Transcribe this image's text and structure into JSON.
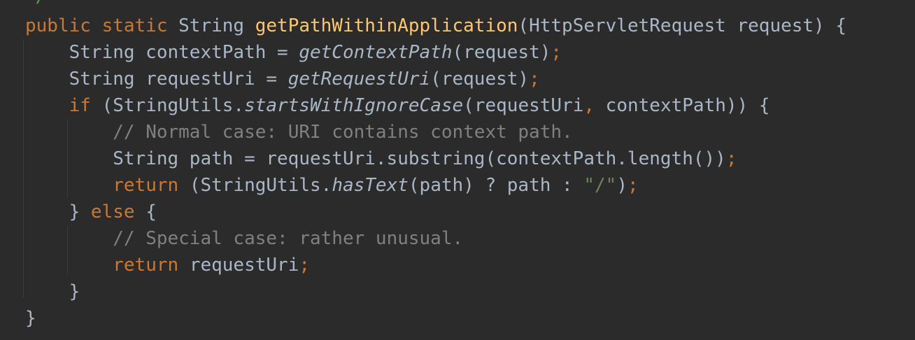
{
  "editor": {
    "top_fragment": "*/",
    "colors": {
      "background": "#2b2b2b",
      "default_text": "#a9b7c6",
      "keyword": "#cc7832",
      "method_declaration": "#ffc66d",
      "comment": "#808080",
      "string": "#6a8759",
      "doc_comment": "#629755"
    },
    "lines": [
      {
        "tokens": [
          {
            "t": "public static ",
            "c": "kw"
          },
          {
            "t": "String ",
            "c": ""
          },
          {
            "t": "getPathWithinApplication",
            "c": "fn"
          },
          {
            "t": "(HttpServletRequest request) {",
            "c": ""
          }
        ]
      },
      {
        "tokens": [
          {
            "t": "    String contextPath = ",
            "c": ""
          },
          {
            "t": "getContextPath",
            "c": "it"
          },
          {
            "t": "(request)",
            "c": ""
          },
          {
            "t": ";",
            "c": "semi"
          }
        ]
      },
      {
        "tokens": [
          {
            "t": "    String requestUri = ",
            "c": ""
          },
          {
            "t": "getRequestUri",
            "c": "it"
          },
          {
            "t": "(request)",
            "c": ""
          },
          {
            "t": ";",
            "c": "semi"
          }
        ]
      },
      {
        "tokens": [
          {
            "t": "    ",
            "c": ""
          },
          {
            "t": "if ",
            "c": "kw"
          },
          {
            "t": "(StringUtils.",
            "c": ""
          },
          {
            "t": "startsWithIgnoreCase",
            "c": "it"
          },
          {
            "t": "(requestUri",
            "c": ""
          },
          {
            "t": ", ",
            "c": "semi"
          },
          {
            "t": "contextPath)) {",
            "c": ""
          }
        ]
      },
      {
        "tokens": [
          {
            "t": "        ",
            "c": ""
          },
          {
            "t": "// Normal case: URI contains context path.",
            "c": "cm"
          }
        ]
      },
      {
        "tokens": [
          {
            "t": "        String path = requestUri.substring(contextPath.length())",
            "c": ""
          },
          {
            "t": ";",
            "c": "semi"
          }
        ]
      },
      {
        "tokens": [
          {
            "t": "        ",
            "c": ""
          },
          {
            "t": "return ",
            "c": "kw"
          },
          {
            "t": "(StringUtils.",
            "c": ""
          },
          {
            "t": "hasText",
            "c": "it"
          },
          {
            "t": "(path) ? path : ",
            "c": ""
          },
          {
            "t": "\"/\"",
            "c": "str"
          },
          {
            "t": ")",
            "c": ""
          },
          {
            "t": ";",
            "c": "semi"
          }
        ]
      },
      {
        "tokens": [
          {
            "t": "    } ",
            "c": ""
          },
          {
            "t": "else ",
            "c": "kw"
          },
          {
            "t": "{",
            "c": ""
          }
        ]
      },
      {
        "tokens": [
          {
            "t": "        ",
            "c": ""
          },
          {
            "t": "// Special case: rather unusual.",
            "c": "cm"
          }
        ]
      },
      {
        "tokens": [
          {
            "t": "        ",
            "c": ""
          },
          {
            "t": "return ",
            "c": "kw"
          },
          {
            "t": "requestUri",
            "c": ""
          },
          {
            "t": ";",
            "c": "semi"
          }
        ]
      },
      {
        "tokens": [
          {
            "t": "    }",
            "c": ""
          }
        ]
      },
      {
        "tokens": [
          {
            "t": "}",
            "c": ""
          }
        ]
      }
    ]
  }
}
